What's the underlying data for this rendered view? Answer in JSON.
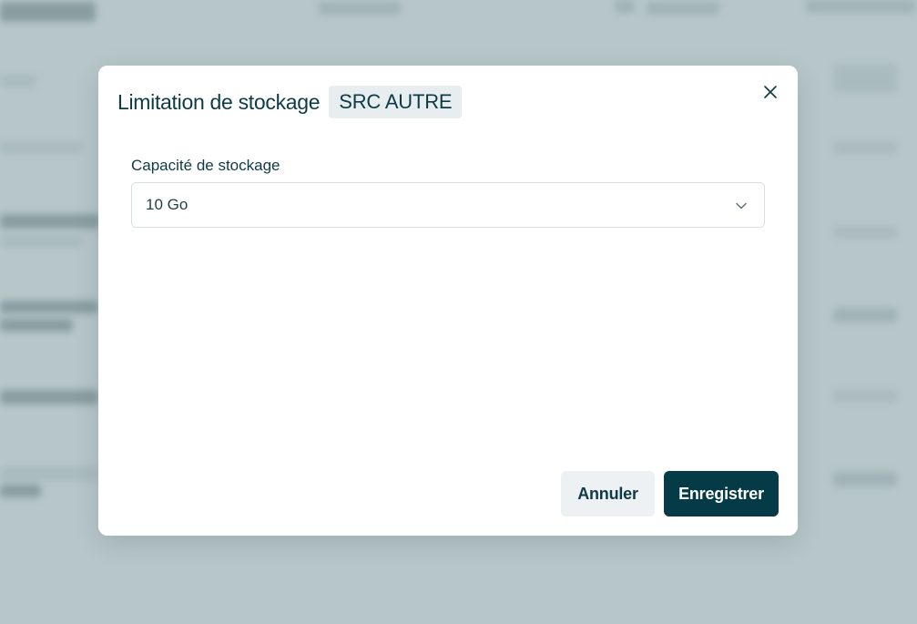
{
  "modal": {
    "title": "Limitation de stockage",
    "badge": "SRC AUTRE",
    "close_icon": "close-icon"
  },
  "form": {
    "storage_label": "Capacité de stockage",
    "storage_value": "10 Go",
    "chevron_icon": "chevron-down-icon"
  },
  "actions": {
    "cancel_label": "Annuler",
    "save_label": "Enregistrer"
  },
  "colors": {
    "primary": "#053b46",
    "text": "#0d3b45",
    "secondary_button": "#edf1f3",
    "overlay": "#b4c4c7"
  }
}
